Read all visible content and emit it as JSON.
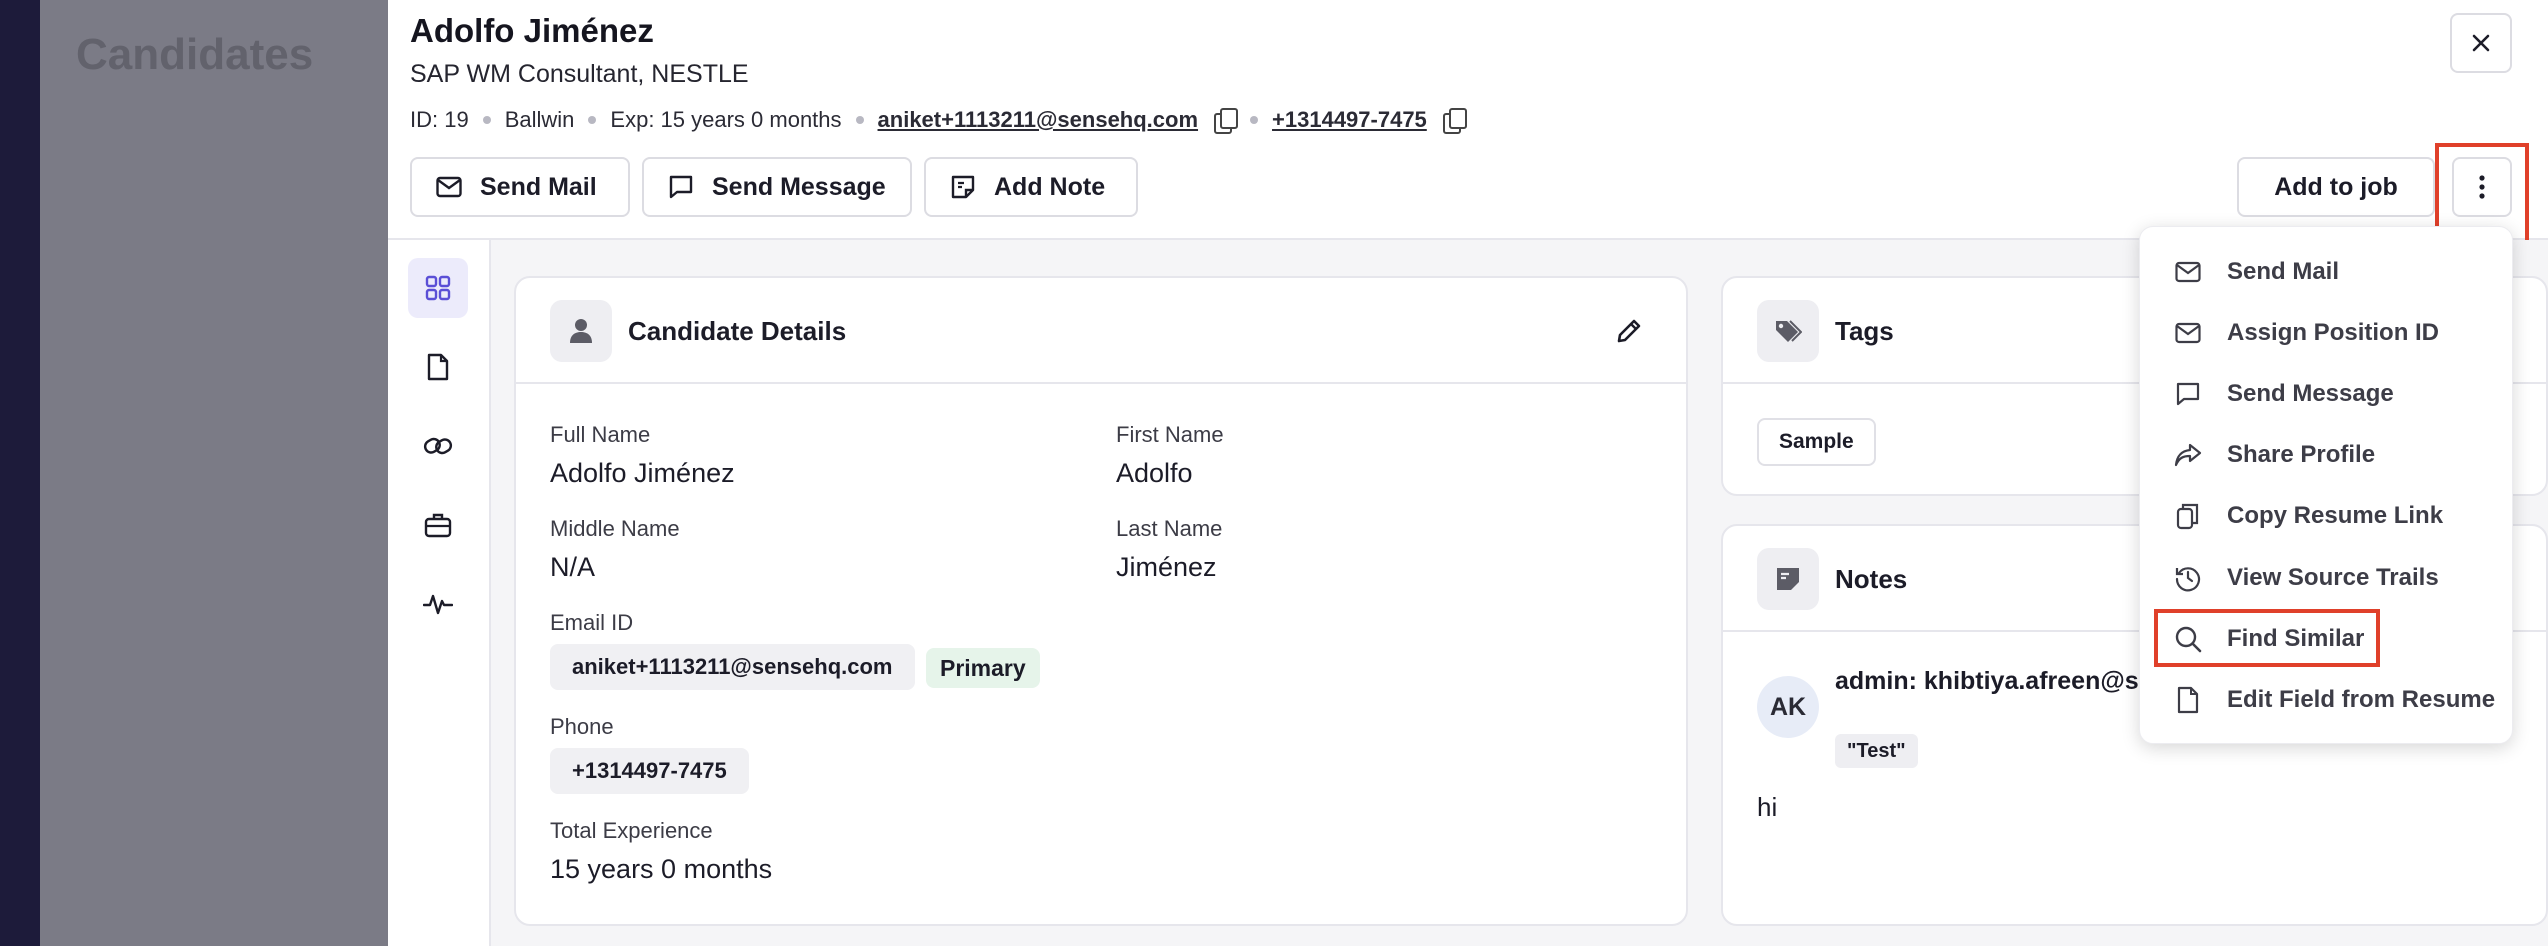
{
  "background": {
    "title": "Candidates"
  },
  "header": {
    "name": "Adolfo Jiménez",
    "title": "SAP WM Consultant, NESTLE",
    "meta": {
      "id": "ID: 19",
      "location": "Ballwin",
      "experience": "Exp: 15 years 0 months",
      "email": "aniket+1113211@sensehq.com",
      "phone": "+1314497-7475"
    },
    "buttons": {
      "send_mail": "Send Mail",
      "send_message": "Send Message",
      "add_note": "Add Note",
      "add_to_job": "Add to job"
    }
  },
  "candidate_details": {
    "heading": "Candidate Details",
    "full_name_label": "Full Name",
    "full_name": "Adolfo Jiménez",
    "first_name_label": "First Name",
    "first_name": "Adolfo",
    "middle_name_label": "Middle Name",
    "middle_name": "N/A",
    "last_name_label": "Last Name",
    "last_name": "Jiménez",
    "email_label": "Email ID",
    "email": "aniket+1113211@sensehq.com",
    "email_badge": "Primary",
    "phone_label": "Phone",
    "phone": "+1314497-7475",
    "experience_label": "Total Experience",
    "experience": "15 years 0 months"
  },
  "tags": {
    "heading": "Tags",
    "items": [
      "Sample"
    ]
  },
  "notes": {
    "heading": "Notes",
    "avatar_initials": "AK",
    "author": "admin: khibtiya.afreen@sensehq.c",
    "quote": "\"Test\"",
    "body": "hi"
  },
  "menu": {
    "items": [
      {
        "label": "Send Mail",
        "icon": "mail-icon"
      },
      {
        "label": "Assign Position ID",
        "icon": "mail-icon"
      },
      {
        "label": "Send Message",
        "icon": "message-icon"
      },
      {
        "label": "Share Profile",
        "icon": "share-icon"
      },
      {
        "label": "Copy Resume Link",
        "icon": "copy-icon"
      },
      {
        "label": "View Source Trails",
        "icon": "history-icon"
      },
      {
        "label": "Find Similar",
        "icon": "search-icon"
      },
      {
        "label": "Edit Field from Resume",
        "icon": "document-icon"
      }
    ]
  },
  "colors": {
    "accent": "#5b4fd6",
    "highlight": "#e0402a",
    "primary_badge_bg": "#e6f4ea"
  }
}
